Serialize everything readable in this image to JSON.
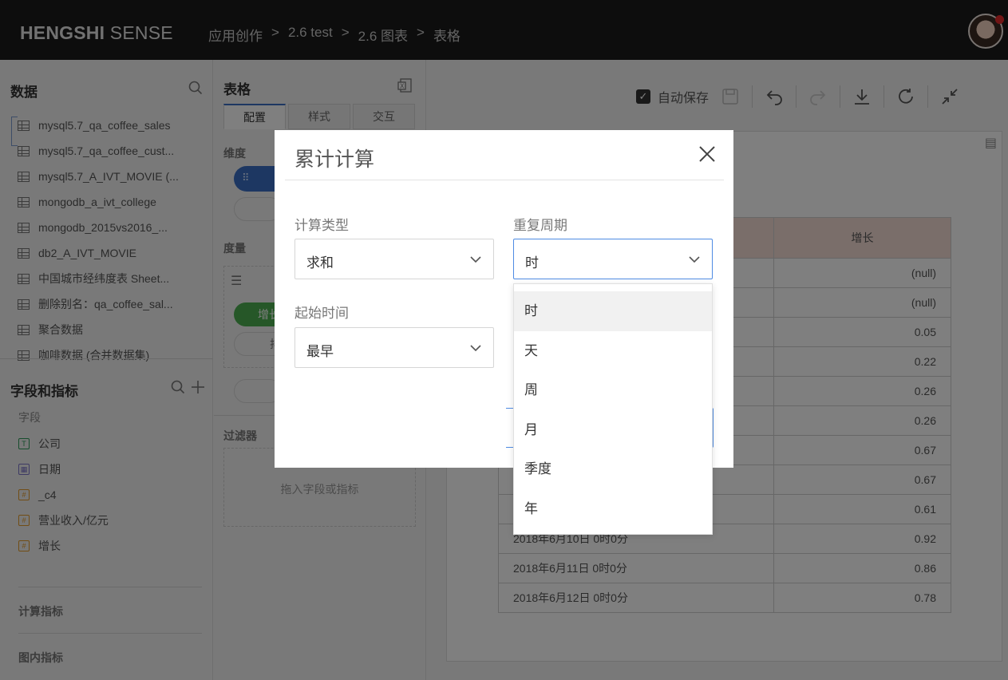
{
  "header": {
    "logo_bold": "HENGSHI",
    "logo_light": "SENSE",
    "breadcrumb": [
      "应用创作",
      ">",
      "2.6 test",
      ">",
      "2.6 图表",
      ">",
      "表格"
    ]
  },
  "data_panel": {
    "title": "数据",
    "datasets": [
      "mysql5.7_qa_coffee_sales",
      "mysql5.7_qa_coffee_cust...",
      "mysql5.7_A_IVT_MOVIE (...",
      "mongodb_a_ivt_college",
      "mongodb_2015vs2016_...",
      "db2_A_IVT_MOVIE",
      "中国城市经纬度表 Sheet...",
      "删除别名：qa_coffee_sal...",
      "聚合数据",
      "咖啡数据 (合并数据集)"
    ]
  },
  "fields_panel": {
    "title": "字段和指标",
    "fields_label": "字段",
    "fields": [
      {
        "type": "T",
        "name": "公司"
      },
      {
        "type": "date",
        "name": "日期"
      },
      {
        "type": "#",
        "name": "_c4"
      },
      {
        "type": "#",
        "name": "营业收入/亿元"
      },
      {
        "type": "#",
        "name": "增长"
      }
    ],
    "calc_metrics": "计算指标",
    "chart_metrics": "图内指标"
  },
  "config_panel": {
    "title": "表格",
    "tabs": [
      "配置",
      "样式",
      "交互"
    ],
    "dimension_label": "维度",
    "measure_label": "度量",
    "measure_pill": "增长",
    "measure_pill_sub": "排",
    "filter_label": "过滤器",
    "filter_placeholder": "拖入字段或指标"
  },
  "toolbar": {
    "autosave_label": "自动保存"
  },
  "table": {
    "header_col2": "增长",
    "rows": [
      {
        "date": "",
        "value": "(null)"
      },
      {
        "date": "",
        "value": "(null)"
      },
      {
        "date": "",
        "value": "0.05"
      },
      {
        "date": "",
        "value": "0.22"
      },
      {
        "date": "",
        "value": "0.26"
      },
      {
        "date": "",
        "value": "0.26"
      },
      {
        "date": "",
        "value": "0.67"
      },
      {
        "date": "",
        "value": "0.67"
      },
      {
        "date": "",
        "value": "0.61"
      },
      {
        "date": "2018年6月10日 0时0分",
        "value": "0.92"
      },
      {
        "date": "2018年6月11日 0时0分",
        "value": "0.86"
      },
      {
        "date": "2018年6月12日 0时0分",
        "value": "0.78"
      }
    ]
  },
  "modal": {
    "title": "累计计算",
    "calc_type_label": "计算类型",
    "calc_type_value": "求和",
    "repeat_label": "重复周期",
    "repeat_value": "时",
    "start_label": "起始时间",
    "start_value": "最早",
    "repeat_options": [
      "时",
      "天",
      "周",
      "月",
      "季度",
      "年"
    ]
  },
  "colors": {
    "header_bg": "#1b1b1b",
    "accent": "#4e8be3",
    "table_header_bg": "#f4dcd4",
    "measure_pill": "#4caf50",
    "dimension_pill": "#3a6fc4"
  }
}
